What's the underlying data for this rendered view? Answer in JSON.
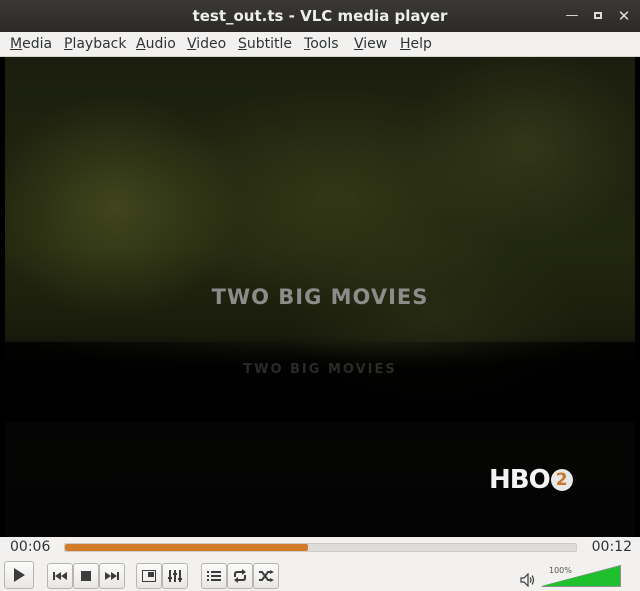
{
  "window": {
    "title": "test_out.ts - VLC media player"
  },
  "menu": {
    "items": [
      "Media",
      "Playback",
      "Audio",
      "Video",
      "Subtitle",
      "Tools",
      "View",
      "Help"
    ]
  },
  "video": {
    "headline": "TWO BIG MOVIES",
    "reflection": "TWO BIG MOVIES",
    "logo_text": "HBO",
    "logo_number": "2"
  },
  "seek": {
    "elapsed": "00:06",
    "total": "00:12",
    "progress_fraction": 0.475,
    "color": "#d27c2a"
  },
  "controls": {
    "buttons": [
      {
        "name": "play-button",
        "icon": "play-icon"
      },
      {
        "name": "previous-button",
        "icon": "skip-back-icon"
      },
      {
        "name": "stop-button",
        "icon": "stop-icon"
      },
      {
        "name": "next-button",
        "icon": "skip-forward-icon"
      },
      {
        "name": "fullscreen-button",
        "icon": "fullscreen-icon"
      },
      {
        "name": "extended-settings-button",
        "icon": "equalizer-icon"
      },
      {
        "name": "playlist-button",
        "icon": "playlist-icon"
      },
      {
        "name": "loop-button",
        "icon": "loop-icon"
      },
      {
        "name": "shuffle-button",
        "icon": "shuffle-icon"
      }
    ]
  },
  "volume": {
    "label": "100%",
    "level_fraction": 1.0,
    "color": "#1fbf2d"
  }
}
